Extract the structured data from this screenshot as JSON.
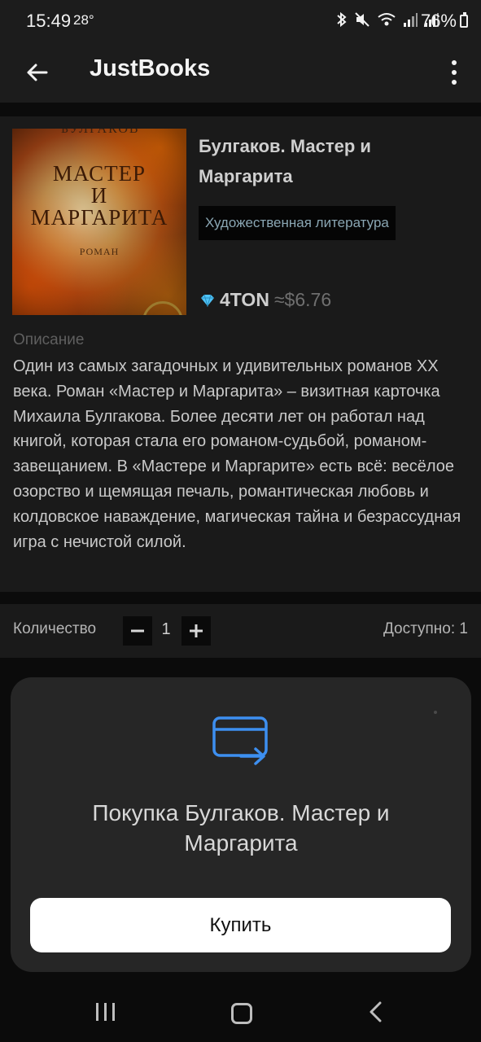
{
  "status_bar": {
    "time": "15:49",
    "temperature": "28°",
    "battery": "76%"
  },
  "app_bar": {
    "title": "JustBooks"
  },
  "book": {
    "cover": {
      "author": "БУЛГАКОВ",
      "title_line1": "МАСТЕР",
      "title_line2": "И",
      "title_line3": "МАРГАРИТА",
      "subtitle": "РОМАН"
    },
    "title": "Булгаков. Мастер и Маргарита",
    "genre": "Художественная литература",
    "price_ton": "4TON",
    "price_usd": "≈$6.76",
    "description_label": "Описание",
    "description": "Один из самых загадочных и удивительных романов XX века. Роман «Мастер и Маргарита» – визитная карточка Михаила Булгакова. Более десяти лет он работал над книгой, которая стала его романом-судьбой, романом-завещанием. В «Мастере и Маргарите» есть всё: весёлое озорство и щемящая печаль, романтическая любовь и колдовское наваждение, магическая тайна и безрассудная игра с нечистой силой."
  },
  "quantity": {
    "label": "Количество",
    "value": "1",
    "available": "Доступно: 1"
  },
  "purchase_sheet": {
    "title": "Покупка Булгаков. Мастер и Маргарита",
    "buy_label": "Купить"
  },
  "colors": {
    "accent_icon": "#3d8ff0",
    "diamond": "#4fc3f7"
  }
}
